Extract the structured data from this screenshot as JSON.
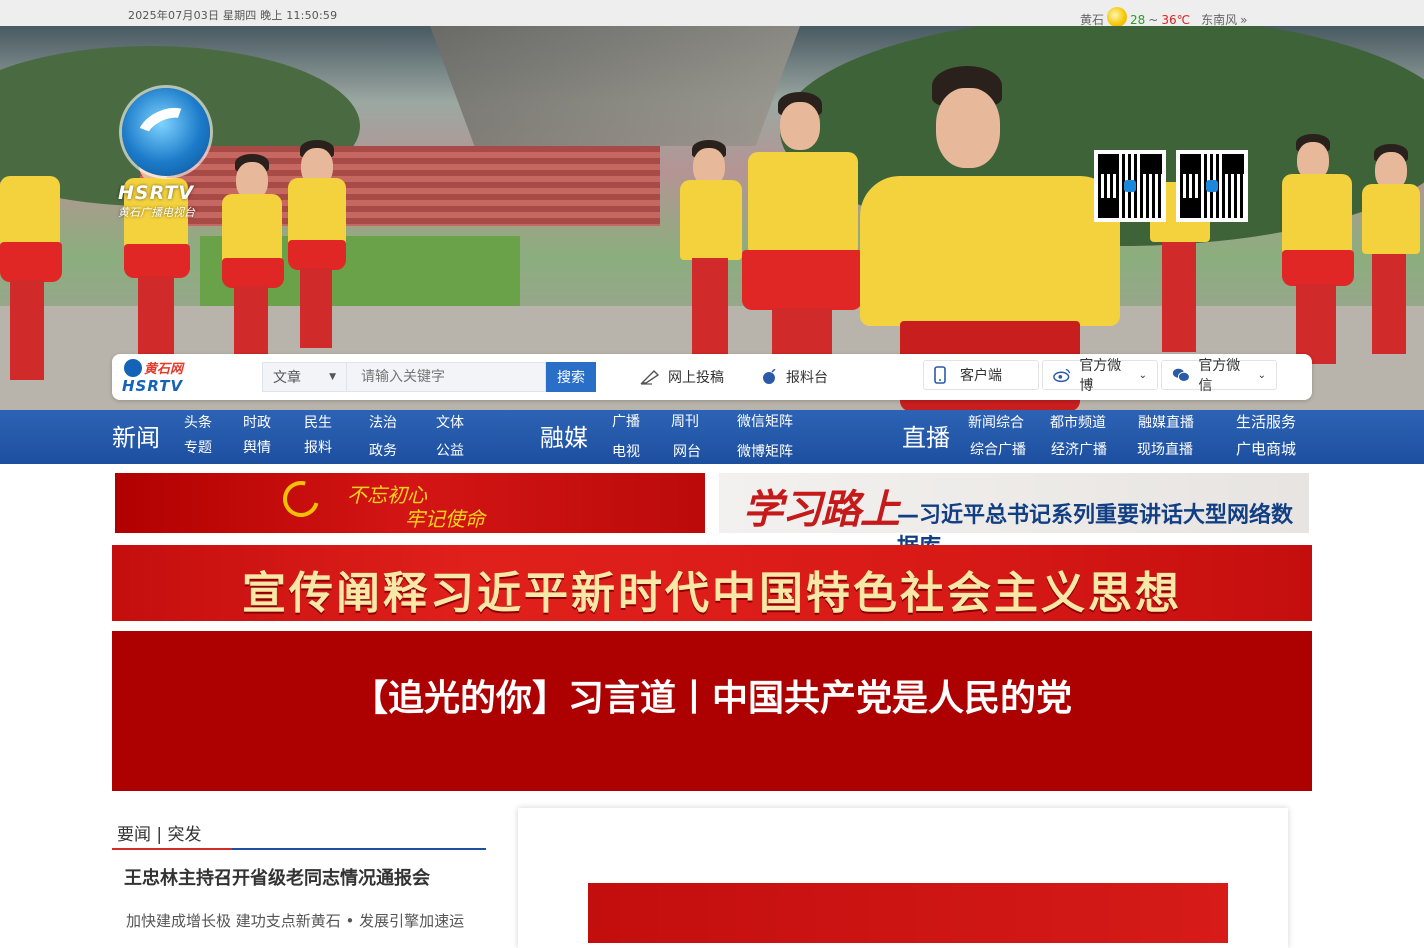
{
  "topbar": {
    "datetime": "2025年07月03日  星期四  晚上  11:50:59",
    "weather": {
      "city": "黄石",
      "low": "28",
      "tilde": "~",
      "high": "36℃",
      "wind": "东南风",
      "more": "»"
    }
  },
  "logo": {
    "hsr": "HSRTV",
    "sub": "黄石广播电视台"
  },
  "searchbar": {
    "logo_top": "黄石网",
    "logo_bottom": "HSRTV",
    "select_value": "文章",
    "placeholder": "请输入关键字",
    "search_btn": "搜索",
    "contribute": "网上投稿",
    "report": "报料台",
    "client": "客户端",
    "weibo": "官方微博",
    "wechat": "官方微信"
  },
  "nav": {
    "news": "新闻",
    "news_items": [
      "头条",
      "时政",
      "民生",
      "法治",
      "文体",
      "专题",
      "舆情",
      "报料",
      "政务",
      "公益"
    ],
    "media": "融媒",
    "media_items": [
      "广播",
      "周刊",
      "微信矩阵",
      "电视",
      "网台",
      "微博矩阵"
    ],
    "live": "直播",
    "live_items": [
      "新闻综合",
      "都市频道",
      "融媒直播",
      "综合广播",
      "经济广播",
      "现场直播"
    ],
    "extra": [
      "生活服务",
      "广电商城"
    ]
  },
  "banners": {
    "a1": "不忘初心",
    "a2": "牢记使命",
    "b_big": "学习路上",
    "b_small": "—习近平总书记系列重要讲话大型网络数据库",
    "c": "宣传阐释习近平新时代中国特色社会主义思想",
    "d": "【追光的你】习言道丨中国共产党是人民的党"
  },
  "news": {
    "tabs": "要闻 | 突发",
    "headline": "王忠林主持召开省级老同志情况通报会",
    "sub": "加快建成增长极 建功支点新黄石 • 发展引擎加速运"
  },
  "colors": {
    "nav_blue": "#1d4f9f",
    "banner_red": "#ad0001",
    "accent_red": "#d32a2a"
  }
}
